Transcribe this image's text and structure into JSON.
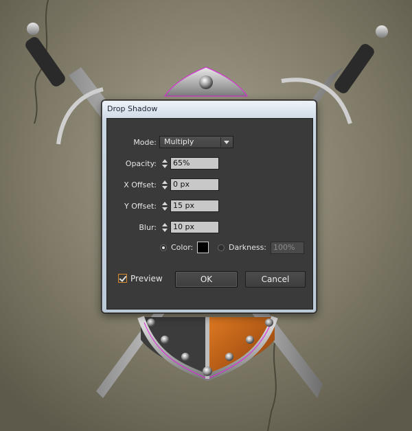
{
  "dialog": {
    "title": "Drop Shadow",
    "mode": {
      "label": "Mode:",
      "value": "Multiply"
    },
    "opacity": {
      "label": "Opacity:",
      "value": "65%"
    },
    "x_offset": {
      "label": "X Offset:",
      "value": "0 px"
    },
    "y_offset": {
      "label": "Y Offset:",
      "value": "15 px"
    },
    "blur": {
      "label": "Blur:",
      "value": "10 px"
    },
    "color": {
      "label": "Color:",
      "selected": true,
      "swatch": "#000000"
    },
    "darkness": {
      "label": "Darkness:",
      "value": "100%",
      "selected": false
    },
    "preview": {
      "label": "Preview",
      "checked": true
    },
    "ok_label": "OK",
    "cancel_label": "Cancel"
  },
  "colors": {
    "accent": "#d98a2b",
    "selection_path": "#e020e0",
    "panel": "#3a3a3a"
  }
}
